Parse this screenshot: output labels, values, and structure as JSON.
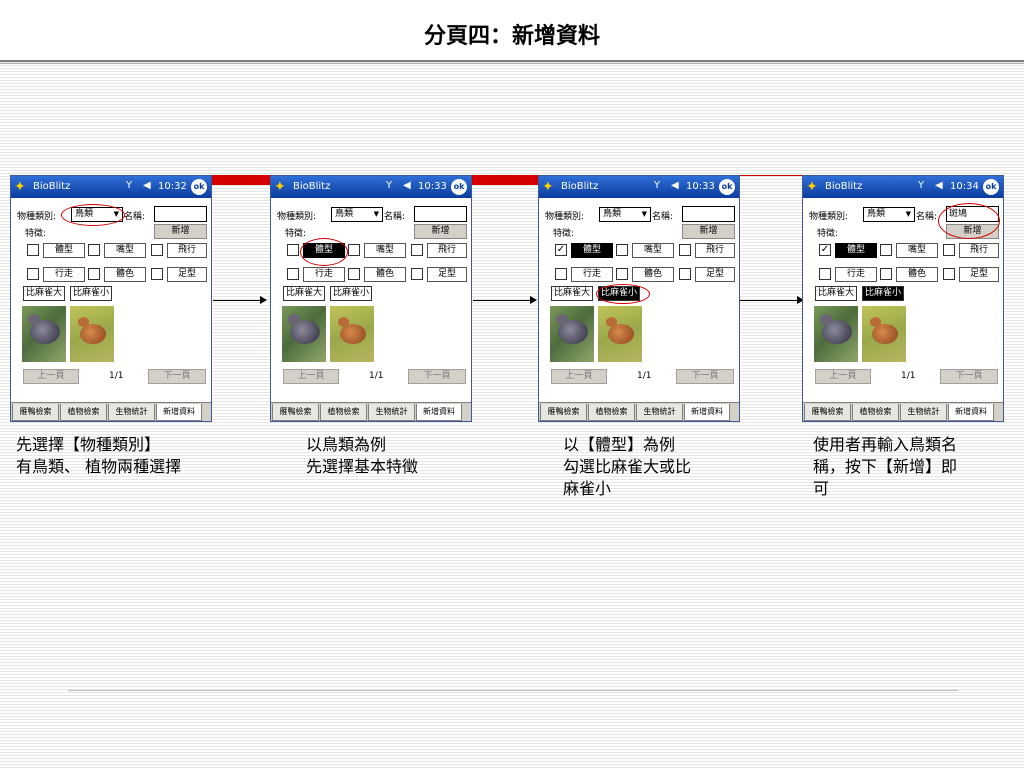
{
  "slide": {
    "title": "分頁四：新增資料"
  },
  "app": {
    "name": "BioBlitz",
    "species_label": "物種類別:",
    "species_value": "鳥類",
    "name_label": "名稱:",
    "feature_label": "特徵:",
    "add_button": "新增",
    "features": [
      "體型",
      "嘴型",
      "飛行",
      "行走",
      "體色",
      "足型"
    ],
    "size_options": [
      "比麻雀大",
      "比麻雀小"
    ],
    "prev_button": "上一頁",
    "next_button": "下一頁",
    "page_indicator": "1/1",
    "tabs": [
      "雁鴨檢索",
      "植物檢索",
      "生物統計",
      "新增資料"
    ]
  },
  "screens": [
    {
      "time": "10:32",
      "name_value": "",
      "body_checked": false,
      "body_selected": false,
      "small_selected": false
    },
    {
      "time": "10:33",
      "name_value": "",
      "body_checked": false,
      "body_selected": true,
      "small_selected": false
    },
    {
      "time": "10:33",
      "name_value": "",
      "body_checked": true,
      "body_selected": true,
      "small_selected": true
    },
    {
      "time": "10:34",
      "name_value": "斑鳩",
      "body_checked": true,
      "body_selected": true,
      "small_selected": true
    }
  ],
  "captions": [
    "先選擇【物種類別】\n有鳥類、 植物兩種選擇",
    "以鳥類為例\n先選擇基本特徵",
    "以【體型】為例\n勾選比麻雀大或比\n麻雀小",
    "使用者再輸入鳥類名\n稱，按下【新增】即\n可"
  ]
}
